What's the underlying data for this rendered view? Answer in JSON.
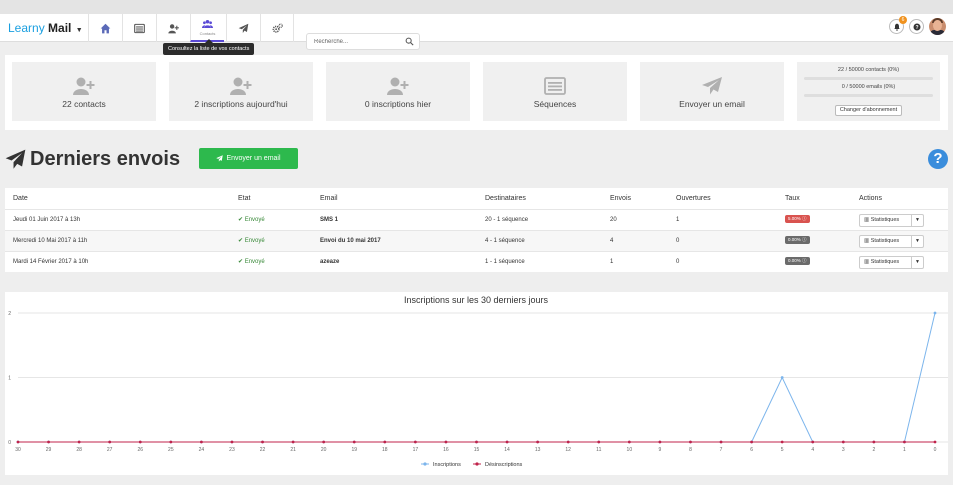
{
  "brand": {
    "part1": "Learny",
    "part2": "Mail"
  },
  "nav": {
    "contacts_sub": "Contacts",
    "tooltip": "Consultez la liste de vos contacts"
  },
  "search": {
    "placeholder": "Recherche..."
  },
  "header": {
    "notifications_count": "6"
  },
  "stats": [
    {
      "label": "22 contacts",
      "icon": "user-plus-icon"
    },
    {
      "label": "2 inscriptions aujourd'hui",
      "icon": "user-plus-icon"
    },
    {
      "label": "0 inscriptions hier",
      "icon": "user-plus-icon"
    },
    {
      "label": "Séquences",
      "icon": "list-icon"
    },
    {
      "label": "Envoyer un email",
      "icon": "paper-plane-icon"
    }
  ],
  "quota": {
    "contacts": "22 / 50000 contacts (0%)",
    "emails": "0 / 50000 emails (0%)",
    "button": "Changer d'abonnement"
  },
  "section": {
    "title": "Derniers envois",
    "send_button": "Envoyer un email",
    "help": "?"
  },
  "table": {
    "headers": [
      "Date",
      "Etat",
      "Email",
      "Destinataires",
      "Envois",
      "Ouvertures",
      "Taux",
      "Actions"
    ],
    "rows": [
      {
        "date": "Jeudi 01 Juin 2017 à 13h",
        "etat": "Envoyé",
        "email": "SMS 1",
        "dest": "20 - 1 séquence",
        "envois": "20",
        "ouv": "1",
        "taux": "5.00%",
        "taux_color": "#d9534f",
        "action": "Statistiques"
      },
      {
        "date": "Mercredi 10 Mai 2017 à 11h",
        "etat": "Envoyé",
        "email": "Envoi du 10 mai 2017",
        "dest": "4 - 1 séquence",
        "envois": "4",
        "ouv": "0",
        "taux": "0.00%",
        "taux_color": "#6b6b6b",
        "action": "Statistiques"
      },
      {
        "date": "Mardi 14 Février 2017 à 10h",
        "etat": "Envoyé",
        "email": "azeaze",
        "dest": "1 - 1 séquence",
        "envois": "1",
        "ouv": "0",
        "taux": "0.00%",
        "taux_color": "#6b6b6b",
        "action": "Statistiques"
      }
    ]
  },
  "chart_data": {
    "type": "line",
    "title": "Inscriptions sur les 30 derniers jours",
    "x": [
      "30",
      "29",
      "28",
      "27",
      "26",
      "25",
      "24",
      "23",
      "22",
      "21",
      "20",
      "19",
      "18",
      "17",
      "16",
      "15",
      "14",
      "13",
      "12",
      "11",
      "10",
      "9",
      "8",
      "7",
      "6",
      "5",
      "4",
      "3",
      "2",
      "1",
      "0"
    ],
    "series": [
      {
        "name": "Inscriptions",
        "color": "#7cb5ec",
        "values": [
          0,
          0,
          0,
          0,
          0,
          0,
          0,
          0,
          0,
          0,
          0,
          0,
          0,
          0,
          0,
          0,
          0,
          0,
          0,
          0,
          0,
          0,
          0,
          0,
          0,
          1,
          0,
          0,
          0,
          0,
          2
        ]
      },
      {
        "name": "Désinscriptions",
        "color": "#c0234b",
        "values": [
          0,
          0,
          0,
          0,
          0,
          0,
          0,
          0,
          0,
          0,
          0,
          0,
          0,
          0,
          0,
          0,
          0,
          0,
          0,
          0,
          0,
          0,
          0,
          0,
          0,
          0,
          0,
          0,
          0,
          0,
          0
        ]
      }
    ],
    "yticks": [
      "0",
      "1",
      "2"
    ],
    "ylim": [
      0,
      2
    ],
    "legend": "bottom-center"
  }
}
